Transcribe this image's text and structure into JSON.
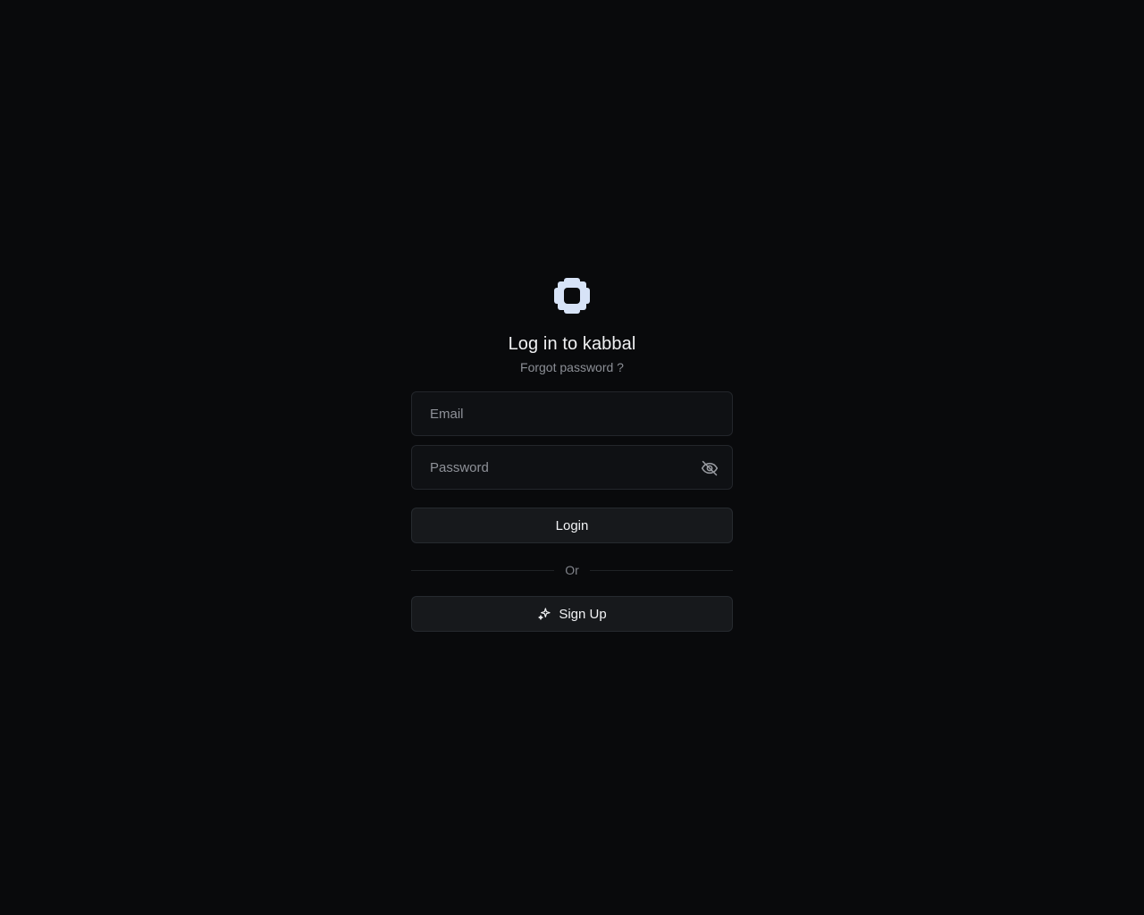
{
  "app": {
    "logo_icon": "kabbal-logo-icon",
    "title": "Log in to kabbal",
    "forgot_password_link": "Forgot password ?"
  },
  "form": {
    "email": {
      "placeholder": "Email",
      "value": ""
    },
    "password": {
      "placeholder": "Password",
      "value": "",
      "visibility_icon": "eye-off-icon"
    },
    "login_label": "Login",
    "divider_text": "Or",
    "signup_label": "Sign Up",
    "signup_icon": "sparkle-icon"
  },
  "colors": {
    "background": "#090a0c",
    "logo": "#d7e3f7",
    "input_background": "#0f1114",
    "button_background": "#17191c",
    "muted_text": "#8c8f96"
  }
}
